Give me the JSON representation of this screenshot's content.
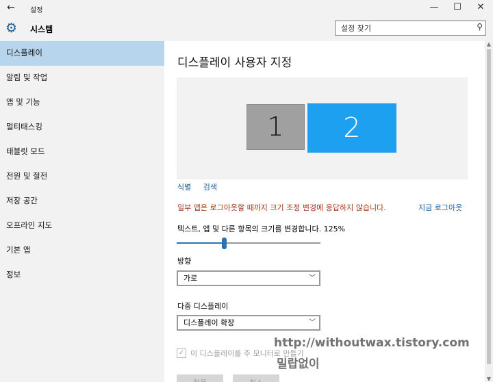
{
  "window": {
    "title": "설정",
    "back_icon": "←",
    "minimize_icon": "—",
    "maximize_icon": "☐",
    "close_icon": "✕"
  },
  "header": {
    "section": "시스템",
    "search_placeholder": "설정 찾기"
  },
  "sidebar": {
    "items": [
      {
        "label": "디스플레이",
        "active": true
      },
      {
        "label": "알림 및 작업"
      },
      {
        "label": "앱 및 기능"
      },
      {
        "label": "멀티태스킹"
      },
      {
        "label": "태블릿 모드"
      },
      {
        "label": "전원 및 절전"
      },
      {
        "label": "저장 공간"
      },
      {
        "label": "오프라인 지도"
      },
      {
        "label": "기본 앱"
      },
      {
        "label": "정보"
      }
    ]
  },
  "main": {
    "title": "디스플레이 사용자 지정",
    "monitors": [
      "1",
      "2"
    ],
    "identify_link": "식별",
    "detect_link": "검색",
    "warning": "일부 앱은 로그아웃할 때까지 크기 조정 변경에 응답하지 않습니다.",
    "logout_now": "지금 로그아웃",
    "scale_label": "텍스트, 앱 및 다른 항목의 크기를 변경합니다. 125%",
    "scale_slider_fraction": 0.33,
    "orientation_label": "방향",
    "orientation_value": "가로",
    "multi_display_label": "다중 디스플레이",
    "multi_display_value": "디스플레이 확장",
    "main_display_checkbox": "이 디스플레이를 주 모니터로 만들기",
    "apply_button": "적용",
    "cancel_button": "취소"
  },
  "watermark": {
    "url": "http://withoutwax.tistory.com",
    "name": "밀랍없이"
  }
}
